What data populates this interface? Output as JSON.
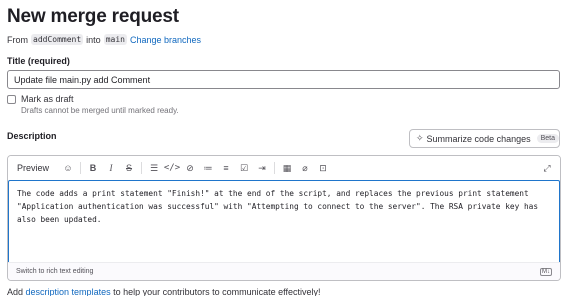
{
  "page": {
    "title": "New merge request"
  },
  "branches": {
    "from_label": "From",
    "source": "addComment",
    "into_label": "into",
    "target": "main",
    "change_link": "Change branches"
  },
  "title_field": {
    "label": "Title (required)",
    "value": "Update file main.py add Comment"
  },
  "draft": {
    "label": "Mark as draft",
    "help": "Drafts cannot be merged until marked ready."
  },
  "description": {
    "label": "Description",
    "summarize_button": "Summarize code changes",
    "beta_badge": "Beta",
    "preview_tab": "Preview",
    "text": "The code adds a print statement \"Finish!\" at the end of the script, and replaces the previous print statement \"Application authentication was successful\" with \"Attempting to connect to the server\". The RSA private key has also been updated.",
    "switch_link": "Switch to rich text editing",
    "toolbar_icons": [
      "tanuki-icon",
      "bold-icon",
      "italic-icon",
      "strikethrough-icon",
      "quote-icon",
      "code-icon",
      "link-icon",
      "bullet-list-icon",
      "numbered-list-icon",
      "task-list-icon",
      "indent-icon",
      "table-icon",
      "attach-icon",
      "quick-action-icon",
      "fullscreen-icon"
    ]
  },
  "footer": {
    "prefix": "Add",
    "link": "description templates",
    "suffix": "to help your contributors to communicate effectively!"
  }
}
